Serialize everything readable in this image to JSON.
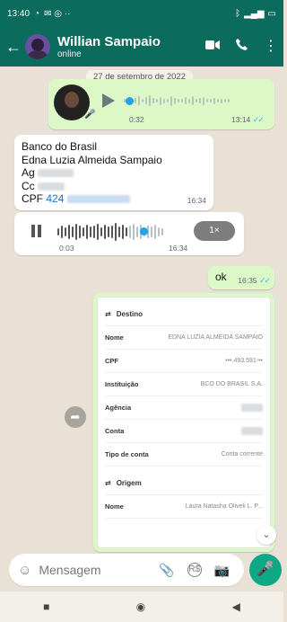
{
  "status_bar": {
    "time": "13:40"
  },
  "header": {
    "name": "Willian Sampaio",
    "status": "online"
  },
  "date_chip": "27 de setembro de 2022",
  "voice1": {
    "duration": "0:32",
    "time": "13:14"
  },
  "text_message": {
    "bank": "Banco do Brasil",
    "holder": "Edna Luzia Almeida Sampaio",
    "ag_label": "Ag",
    "cc_label": "Cc",
    "cpf_label": "CPF",
    "cpf_value": "424",
    "time": "16:34"
  },
  "voice2": {
    "duration": "0:03",
    "time": "16:34",
    "speed": "1×"
  },
  "ok_message": {
    "text": "ok",
    "time": "16:35"
  },
  "document": {
    "destino_title": "Destino",
    "rows": [
      {
        "k": "Nome",
        "v": "EDNA LUZIA ALMEIDA SAMPAIO"
      },
      {
        "k": "CPF",
        "v": "•••.493.591-••"
      },
      {
        "k": "Instituição",
        "v": "BCO DO BRASIL S.A."
      },
      {
        "k": "Agência",
        "v": ""
      },
      {
        "k": "Conta",
        "v": ""
      },
      {
        "k": "Tipo de conta",
        "v": "Conta corrente"
      }
    ],
    "origem_title": "Origem",
    "origem_row": {
      "k": "Nome",
      "v": "Laura Natasha Oliveli L. P..."
    }
  },
  "composer": {
    "placeholder": "Mensagem"
  }
}
